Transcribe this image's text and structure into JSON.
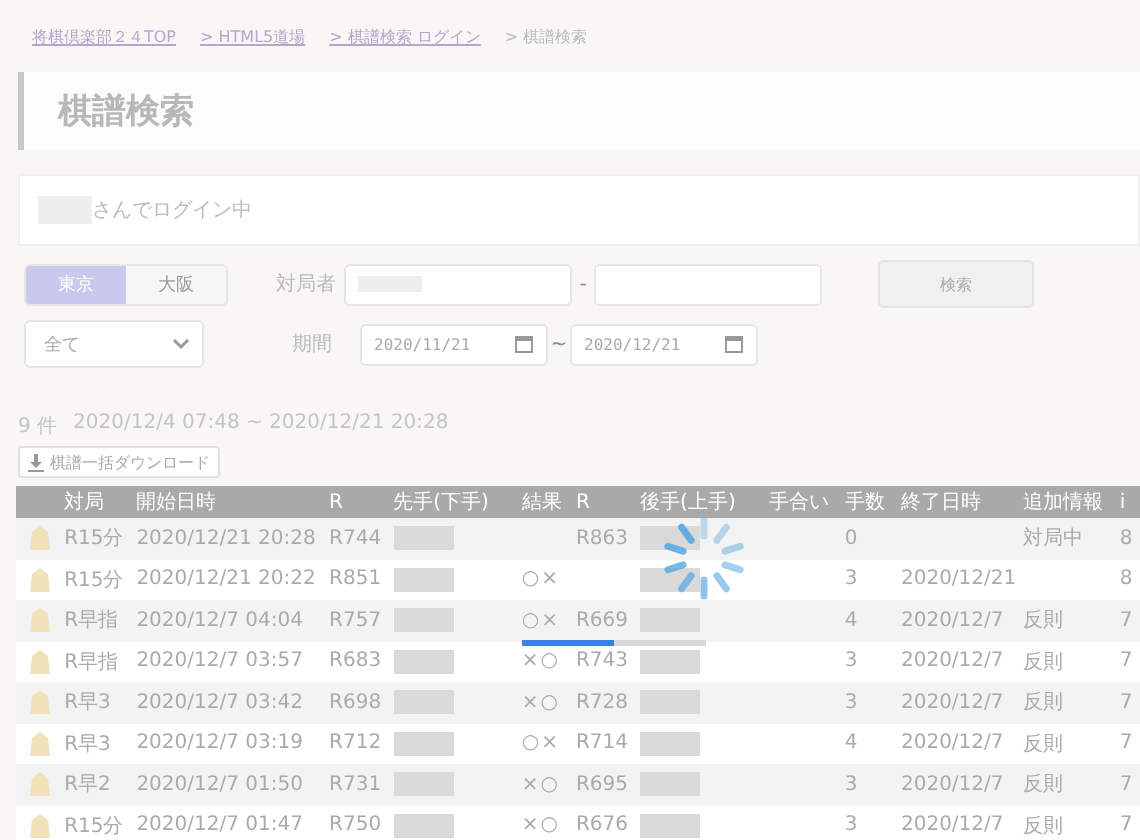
{
  "breadcrumb": [
    {
      "label": "将棋倶楽部２４TOP",
      "link": true
    },
    {
      "label": "> HTML5道場",
      "link": true
    },
    {
      "label": "> 棋譜検索 ログイン",
      "link": true
    },
    {
      "label": "> 棋譜検索",
      "link": false
    }
  ],
  "title": "棋譜検索",
  "login_text": "さんでログイン中",
  "servers": [
    {
      "label": "東京",
      "selected": true
    },
    {
      "label": "大阪",
      "selected": false
    }
  ],
  "player_label": "対局者",
  "player_separator": "-",
  "search_button": "検索",
  "game_type": {
    "value": "全て"
  },
  "period_label": "期間",
  "period_from": "2020/11/21",
  "period_separator": "~",
  "period_to": "2020/12/21",
  "summary": {
    "count": "9 件",
    "range": "2020/12/4 07:48 ~ 2020/12/21 20:28"
  },
  "download_button": "棋譜一括ダウンロード",
  "table": {
    "columns": [
      "対局",
      "開始日時",
      "R",
      "先手(下手)",
      "結果",
      "R",
      "後手(上手)",
      "手合い",
      "手数",
      "終了日時",
      "追加情報",
      "i"
    ],
    "rows": [
      {
        "type": "R15分",
        "start": "2020/12/21 20:28",
        "r1": "R744",
        "r2": "R863",
        "moves": "0",
        "info": "対局中",
        "column_13": "8"
      },
      {
        "type": "R15分",
        "start": "2020/12/21 20:22",
        "r1": "R851",
        "result": "○×",
        "moves": "3",
        "end": "2020/12/21",
        "column_13": "8"
      },
      {
        "type": "R早指",
        "start": "2020/12/7 04:04",
        "r1": "R757",
        "result": "○×",
        "r2": "R669",
        "moves": "4",
        "end": "2020/12/7",
        "info": "反則",
        "column_13": "7"
      },
      {
        "type": "R早指",
        "start": "2020/12/7 03:57",
        "r1": "R683",
        "result": "×○",
        "r2": "R743",
        "moves": "3",
        "end": "2020/12/7",
        "info": "反則",
        "column_13": "7"
      },
      {
        "type": "R早3",
        "start": "2020/12/7 03:42",
        "r1": "R698",
        "result": "×○",
        "r2": "R728",
        "moves": "3",
        "end": "2020/12/7",
        "info": "反則",
        "column_13": "7"
      },
      {
        "type": "R早3",
        "start": "2020/12/7 03:19",
        "r1": "R712",
        "result": "○×",
        "r2": "R714",
        "moves": "4",
        "end": "2020/12/7",
        "info": "反則",
        "column_13": "7"
      },
      {
        "type": "R早2",
        "start": "2020/12/7 01:50",
        "r1": "R731",
        "result": "×○",
        "r2": "R695",
        "moves": "3",
        "end": "2020/12/7",
        "info": "反則",
        "column_13": "7"
      },
      {
        "type": "R15分",
        "start": "2020/12/7 01:47",
        "r1": "R750",
        "result": "×○",
        "r2": "R676",
        "moves": "3",
        "end": "2020/12/7",
        "info": "反則",
        "column_13": "7"
      }
    ]
  },
  "loading": {
    "level": 0.5
  }
}
